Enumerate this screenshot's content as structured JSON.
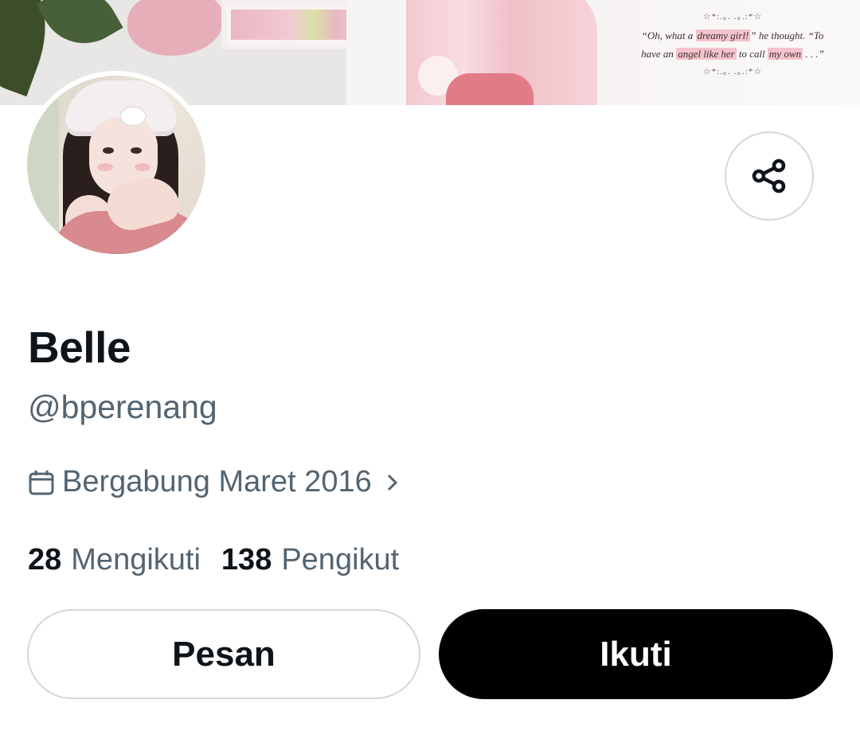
{
  "banner": {
    "quote_stars_top": "☆*:.｡. .｡.:*☆",
    "quote_line1_a": "“Oh, what a ",
    "quote_line1_hl": "dreamy girl!",
    "quote_line1_b": "” he thought. “To",
    "quote_line2_a": "have an ",
    "quote_line2_hl1": "angel like her",
    "quote_line2_b": " to call ",
    "quote_line2_hl2": "my own",
    "quote_line2_c": " . . .”",
    "quote_stars_bottom": "☆*:.｡. .｡.:*☆"
  },
  "profile": {
    "name": "Belle",
    "handle": "@bperenang",
    "joined": "Bergabung Maret 2016",
    "following_count": "28",
    "following_label": "Mengikuti",
    "followers_count": "138",
    "followers_label": "Pengikut"
  },
  "actions": {
    "message_label": "Pesan",
    "follow_label": "Ikuti"
  },
  "icons": {
    "share": "share-icon",
    "calendar": "calendar-icon",
    "chevron": "chevron-right-icon"
  },
  "colors": {
    "text_primary": "#0f1419",
    "text_secondary": "#536471",
    "border": "#cfd9de",
    "follow_bg": "#000000"
  }
}
